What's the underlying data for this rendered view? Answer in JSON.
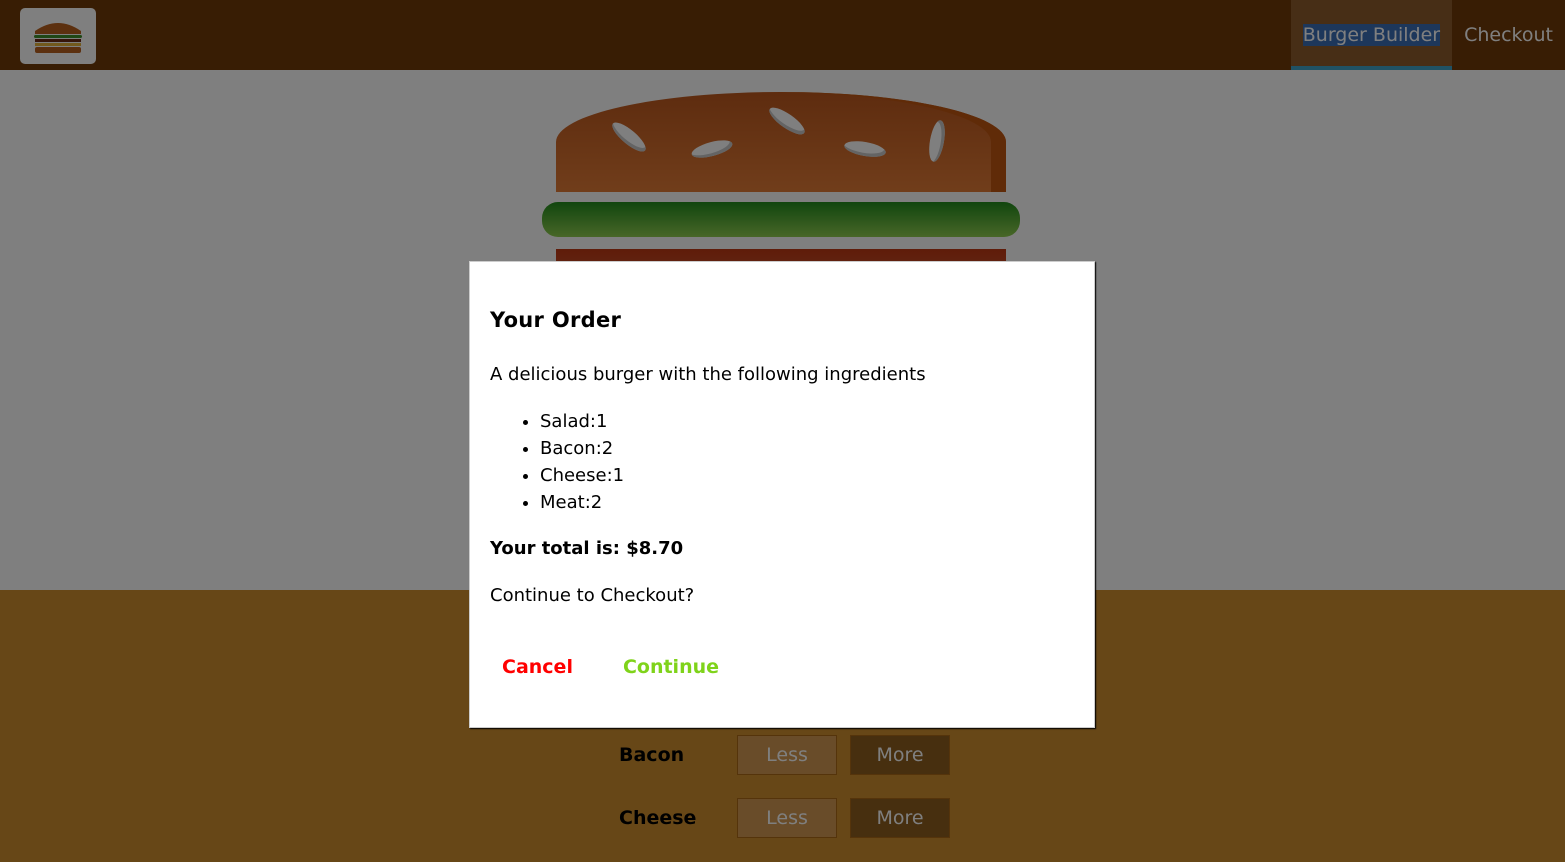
{
  "toolbar": {
    "logo_icon": "burger-logo-icon",
    "nav": [
      {
        "label": "Burger Builder",
        "active": true
      },
      {
        "label": "Checkout",
        "active": false
      }
    ]
  },
  "controls": [
    {
      "label": "Bacon",
      "less": "Less",
      "more": "More"
    },
    {
      "label": "Cheese",
      "less": "Less",
      "more": "More"
    }
  ],
  "modal": {
    "title": "Your Order",
    "description": "A delicious burger with the following ingredients",
    "ingredients": [
      "Salad:1",
      "Bacon:2",
      "Cheese:1",
      "Meat:2"
    ],
    "total": "Your total is: $8.70",
    "question": "Continue to Checkout?",
    "cancel_label": "Cancel",
    "continue_label": "Continue"
  },
  "colors": {
    "toolbar": "#703b09",
    "controls_bg": "#cf8f2e",
    "cancel": "#ff0000",
    "continue": "#7fd31a"
  }
}
